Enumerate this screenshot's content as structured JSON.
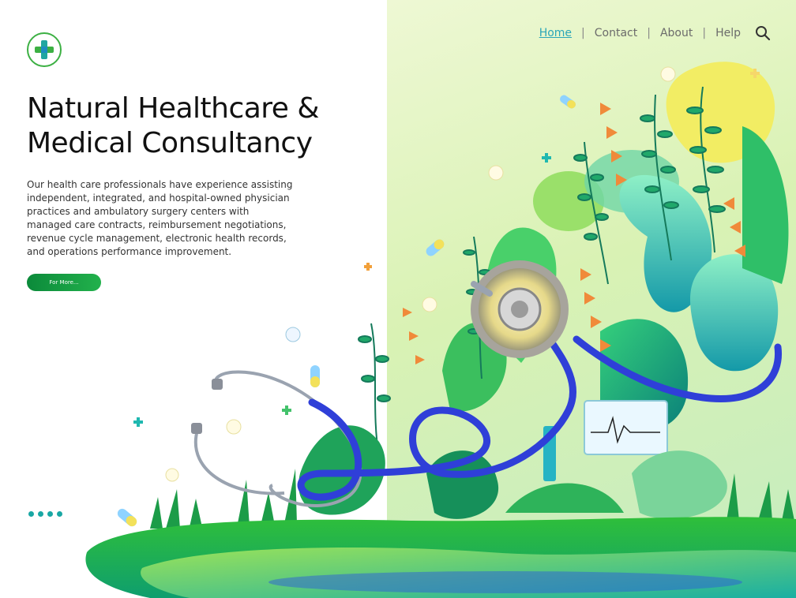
{
  "nav": {
    "items": [
      "Home",
      "Contact",
      "About",
      "Help"
    ],
    "active": "Home",
    "separator": "|",
    "search_icon": "search-icon"
  },
  "logo": {
    "icon": "medical-cross-icon"
  },
  "hero": {
    "title": "Natural Healthcare & Medical Consultancy",
    "description": "Our health care professionals have experience assisting independent, integrated, and hospital-owned physician practices and ambulatory surgery centers with managed care contracts, reimbursement negotiations, revenue cycle management, electronic health records, and operations performance improvement.",
    "cta_label": "For More..."
  },
  "slider": {
    "dots": 4
  },
  "illustration": {
    "name": "stethoscope-in-jungle-illustration",
    "colors": {
      "accent": "#2aa6b8",
      "green": "#22b14c",
      "tube": "#2f3fd8"
    }
  }
}
